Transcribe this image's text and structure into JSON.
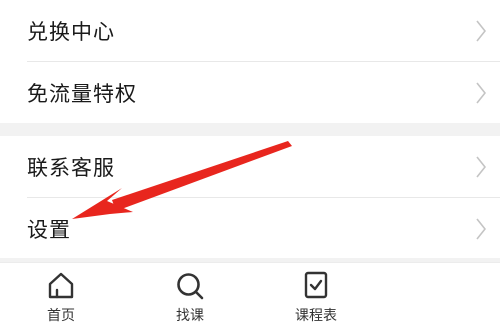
{
  "menu": {
    "group1": [
      {
        "label": "兑换中心"
      },
      {
        "label": "免流量特权"
      }
    ],
    "group2": [
      {
        "label": "联系客服"
      },
      {
        "label": "设置"
      }
    ]
  },
  "tabbar": {
    "items": [
      {
        "label": "首页",
        "icon": "home-icon"
      },
      {
        "label": "找课",
        "icon": "search-icon"
      },
      {
        "label": "课程表",
        "icon": "schedule-icon"
      }
    ]
  },
  "colors": {
    "annotation_arrow": "#e8261e",
    "background": "#f2f2f2",
    "text": "#1a1a1a"
  }
}
